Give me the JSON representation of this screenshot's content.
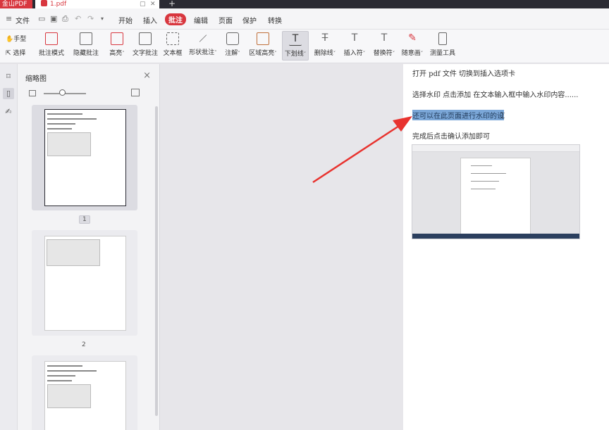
{
  "titlebar": {
    "app_name": "金山PDF",
    "doc_tab": "1.pdf",
    "pin": "▢",
    "close": "✕",
    "new_tab": "+"
  },
  "menubar": {
    "file": "文件",
    "tabs": [
      "开始",
      "插入",
      "批注",
      "编辑",
      "页面",
      "保护",
      "转换"
    ],
    "active_tab": "批注"
  },
  "ribbon": {
    "hand_tool": "手型",
    "select_tool": "选择",
    "buttons": [
      "批注模式",
      "隐藏批注",
      "高亮",
      "文字批注",
      "文本框",
      "形状批注",
      "注解",
      "区域高亮",
      "下划线",
      "删除线",
      "插入符",
      "替换符",
      "随意画",
      "测量工具"
    ],
    "selected": "下划线"
  },
  "sidebar": {
    "title": "缩略图",
    "pages": [
      {
        "label": "1"
      },
      {
        "label": "2"
      }
    ]
  },
  "document": {
    "lines": [
      "打开 pdf 文件   切换到插入选项卡",
      "选择水印    点击添加   在文本输入框中输入水印内容......",
      "还可以在此页面进行水印的设",
      "完成后点击确认添加即可"
    ],
    "highlighted_index": 2,
    "colors": {
      "accent": "#d8373f",
      "highlight": "#7ba7d8",
      "arrow": "#e8332f"
    }
  }
}
